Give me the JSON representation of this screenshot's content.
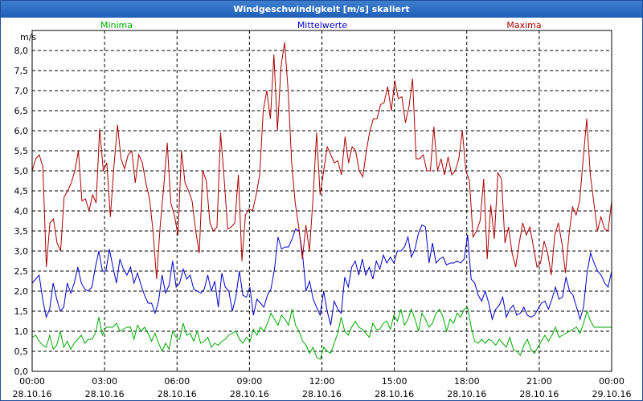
{
  "window": {
    "title": "Windgeschwindigkeit [m/s] skaliert"
  },
  "chart_data": {
    "type": "line",
    "title": "Windgeschwindigkeit [m/s] skaliert",
    "ylabel": "m/s",
    "ylim": [
      0,
      8.5
    ],
    "yticks": [
      "0,0",
      "0,5",
      "1,0",
      "1,5",
      "2,0",
      "2,5",
      "3,0",
      "3,5",
      "4,0",
      "4,5",
      "5,0",
      "5,5",
      "6,0",
      "6,5",
      "7,0",
      "7,5",
      "8,0"
    ],
    "xticks": [
      {
        "time": "00:00",
        "date": "28.10.16"
      },
      {
        "time": "03:00",
        "date": "28.10.16"
      },
      {
        "time": "06:00",
        "date": "28.10.16"
      },
      {
        "time": "09:00",
        "date": "28.10.16"
      },
      {
        "time": "12:00",
        "date": "28.10.16"
      },
      {
        "time": "15:00",
        "date": "28.10.16"
      },
      {
        "time": "18:00",
        "date": "28.10.16"
      },
      {
        "time": "21:00",
        "date": "28.10.16"
      },
      {
        "time": "00:00",
        "date": "29.10.16"
      }
    ],
    "x_hours_start": 0,
    "x_hours_end": 24,
    "grid": true,
    "legend_placement": "top",
    "series": [
      {
        "name": "Minima",
        "color": "#00aa00",
        "values": [
          0.85,
          0.9,
          0.75,
          0.65,
          0.6,
          0.9,
          0.55,
          0.65,
          1.0,
          0.6,
          0.75,
          0.55,
          0.7,
          0.8,
          0.9,
          0.7,
          0.8,
          0.8,
          0.95,
          1.35,
          0.9,
          1.1,
          1.1,
          1.1,
          1.2,
          1.0,
          1.05,
          1.1,
          1.1,
          0.8,
          1.15,
          1.0,
          1.1,
          0.95,
          0.75,
          0.95,
          0.7,
          0.5,
          0.7,
          0.55,
          1.0,
          0.85,
          0.8,
          1.2,
          0.9,
          0.95,
          0.75,
          1.0,
          0.7,
          0.75,
          0.85,
          0.6,
          0.7,
          0.65,
          0.75,
          0.8,
          0.9,
          0.95,
          1.0,
          0.8,
          0.7,
          0.85,
          0.75,
          1.05,
          0.9,
          1.1,
          1.0,
          1.2,
          1.45,
          1.3,
          1.15,
          1.4,
          1.3,
          1.15,
          1.55,
          1.15,
          1.0,
          0.75,
          0.65,
          0.45,
          0.6,
          0.35,
          0.3,
          0.6,
          0.5,
          0.45,
          0.7,
          0.95,
          1.35,
          1.0,
          0.9,
          1.1,
          1.25,
          1.1,
          1.05,
          0.95,
          0.85,
          1.2,
          1.05,
          1.05,
          1.2,
          1.25,
          1.05,
          1.4,
          1.25,
          1.55,
          1.15,
          1.3,
          1.55,
          1.3,
          1.0,
          1.45,
          1.3,
          1.1,
          1.2,
          1.45,
          1.55,
          1.35,
          1.0,
          1.3,
          1.2,
          1.45,
          1.35,
          1.55,
          1.6,
          1.1,
          0.75,
          0.7,
          0.8,
          0.7,
          0.8,
          0.75,
          0.65,
          0.8,
          0.7,
          0.6,
          0.85,
          0.55,
          0.5,
          0.4,
          0.65,
          0.8,
          0.55,
          0.45,
          0.6,
          0.75,
          0.9,
          0.75,
          0.9,
          1.1,
          0.85,
          0.9,
          0.95,
          1.0,
          1.05,
          1.1,
          0.95,
          1.2,
          1.5,
          1.25,
          1.1,
          1.1,
          1.1,
          1.1,
          1.1,
          1.1
        ]
      },
      {
        "name": "Mittelwerte",
        "color": "#0000cc",
        "values": [
          2.2,
          2.3,
          2.4,
          1.8,
          1.35,
          1.55,
          2.2,
          1.8,
          1.5,
          1.6,
          2.2,
          1.95,
          2.2,
          2.6,
          2.2,
          2.05,
          2.0,
          2.1,
          2.6,
          3.0,
          2.5,
          2.5,
          3.05,
          2.6,
          2.2,
          2.8,
          2.55,
          2.4,
          2.6,
          2.2,
          2.45,
          2.15,
          1.9,
          1.7,
          1.7,
          1.45,
          1.75,
          2.4,
          1.95,
          2.15,
          2.75,
          2.1,
          2.2,
          2.55,
          2.3,
          2.4,
          2.05,
          2.0,
          1.95,
          2.05,
          2.4,
          2.0,
          2.25,
          1.6,
          2.45,
          2.1,
          2.0,
          1.5,
          1.85,
          2.5,
          1.9,
          1.85,
          2.1,
          1.4,
          1.8,
          1.7,
          1.6,
          1.9,
          2.05,
          2.55,
          3.35,
          3.05,
          3.1,
          3.1,
          3.3,
          3.55,
          3.5,
          2.9,
          2.0,
          2.25,
          1.8,
          1.6,
          1.4,
          2.0,
          1.5,
          1.15,
          1.75,
          1.55,
          1.45,
          2.35,
          2.1,
          2.6,
          2.75,
          2.4,
          2.8,
          2.4,
          2.6,
          2.3,
          2.75,
          2.55,
          2.9,
          2.7,
          2.85,
          2.7,
          3.0,
          3.0,
          3.1,
          3.35,
          2.85,
          3.05,
          3.45,
          3.65,
          3.6,
          2.7,
          3.2,
          2.7,
          2.8,
          2.85,
          2.65,
          2.7,
          2.7,
          2.75,
          2.7,
          2.8,
          3.4,
          2.3,
          2.2,
          1.9,
          1.75,
          2.0,
          1.7,
          1.3,
          1.55,
          1.65,
          1.85,
          1.35,
          1.55,
          1.65,
          1.4,
          1.45,
          1.6,
          1.4,
          1.35,
          1.4,
          1.55,
          1.7,
          1.75,
          1.55,
          1.8,
          2.1,
          1.8,
          1.85,
          2.35,
          2.0,
          1.9,
          1.6,
          1.3,
          1.6,
          2.45,
          2.95,
          2.7,
          2.5,
          2.4,
          2.2,
          2.1,
          2.5
        ]
      },
      {
        "name": "Maxima",
        "color": "#aa0000",
        "values": [
          5.0,
          5.3,
          5.4,
          5.1,
          2.6,
          3.7,
          3.8,
          3.2,
          3.0,
          4.35,
          4.5,
          4.7,
          5.0,
          5.5,
          4.25,
          4.3,
          4.0,
          4.4,
          4.2,
          6.05,
          5.0,
          5.2,
          3.85,
          5.1,
          6.15,
          5.3,
          5.05,
          5.4,
          5.5,
          4.7,
          5.4,
          5.2,
          4.7,
          4.3,
          3.5,
          2.3,
          3.6,
          4.6,
          5.7,
          4.2,
          3.9,
          3.4,
          5.5,
          4.7,
          4.5,
          4.25,
          3.5,
          2.95,
          5.0,
          4.75,
          3.7,
          3.5,
          3.6,
          5.95,
          4.8,
          3.55,
          3.6,
          3.7,
          4.9,
          2.75,
          3.9,
          4.05,
          4.0,
          4.4,
          4.9,
          6.5,
          7.0,
          6.3,
          7.9,
          6.0,
          7.6,
          8.2,
          7.0,
          5.2,
          4.2,
          3.6,
          2.8,
          3.65,
          3.0,
          4.3,
          5.95,
          4.4,
          5.0,
          5.6,
          5.4,
          5.2,
          5.25,
          4.9,
          5.85,
          5.2,
          5.6,
          5.5,
          5.0,
          4.85,
          5.5,
          6.0,
          6.3,
          6.3,
          6.65,
          6.7,
          7.1,
          6.5,
          7.25,
          6.8,
          6.85,
          6.2,
          6.6,
          7.3,
          5.3,
          5.3,
          5.4,
          5.0,
          5.0,
          6.1,
          5.0,
          5.3,
          4.9,
          5.35,
          4.9,
          5.0,
          5.3,
          6.0,
          5.0,
          4.75,
          3.35,
          3.5,
          3.75,
          4.8,
          2.8,
          4.15,
          3.3,
          4.95,
          4.8,
          3.2,
          3.6,
          2.95,
          2.6,
          3.2,
          3.7,
          3.4,
          3.6,
          3.1,
          2.6,
          2.7,
          3.25,
          2.95,
          2.4,
          3.4,
          3.7,
          3.2,
          2.45,
          3.4,
          4.1,
          3.9,
          4.25,
          5.3,
          6.3,
          4.9,
          4.2,
          3.5,
          3.85,
          3.55,
          3.5,
          4.25
        ]
      }
    ]
  }
}
